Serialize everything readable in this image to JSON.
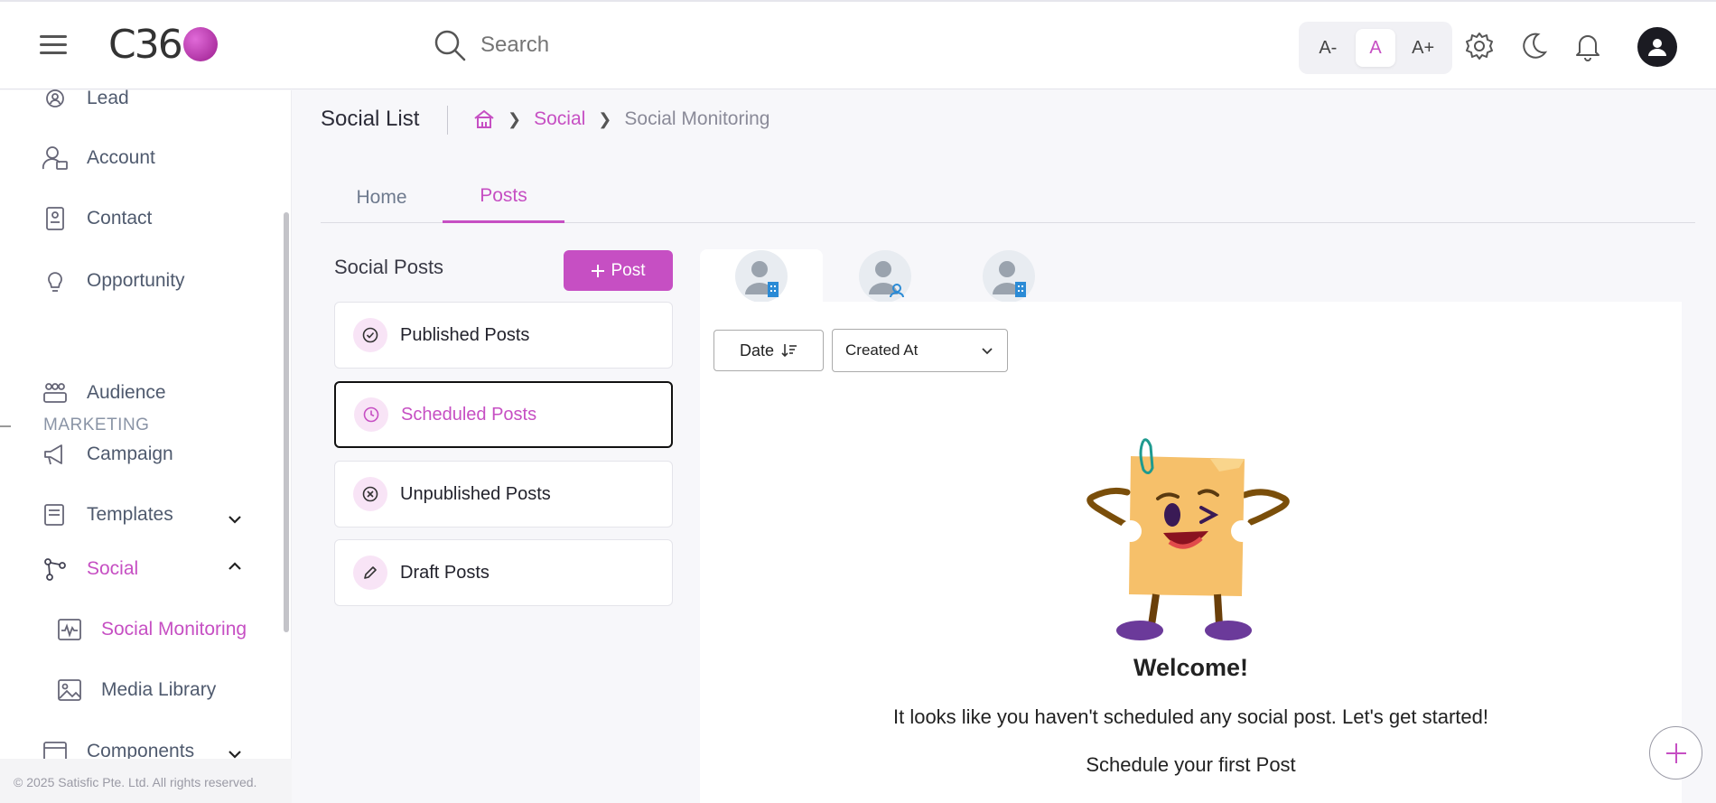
{
  "header": {
    "logo_text": "C36",
    "search_placeholder": "Search",
    "font_sizes": [
      "A-",
      "A",
      "A+"
    ],
    "accent_color": "#c64fc3"
  },
  "sidebar": {
    "items": [
      {
        "label": "Lead",
        "icon": "lead-icon"
      },
      {
        "label": "Account",
        "icon": "account-icon"
      },
      {
        "label": "Contact",
        "icon": "contact-icon"
      },
      {
        "label": "Opportunity",
        "icon": "lightbulb-icon"
      }
    ],
    "section_marketing": "MARKETING",
    "marketing_items": [
      {
        "label": "Audience",
        "icon": "audience-icon"
      },
      {
        "label": "Campaign",
        "icon": "megaphone-icon"
      },
      {
        "label": "Templates",
        "icon": "templates-icon"
      },
      {
        "label": "Social",
        "icon": "share-icon"
      },
      {
        "label": "Social Monitoring",
        "icon": "monitoring-icon"
      },
      {
        "label": "Media Library",
        "icon": "image-icon"
      },
      {
        "label": "Components",
        "icon": "components-icon"
      }
    ],
    "footer": "© 2025 Satisfic Pte. Ltd. All rights reserved."
  },
  "page": {
    "title": "Social List",
    "breadcrumb": {
      "home_icon": "home-icon",
      "section": "Social",
      "current": "Social Monitoring"
    },
    "tabs": [
      "Home",
      "Posts"
    ],
    "active_tab": "Posts"
  },
  "posts": {
    "title": "Social Posts",
    "add_button": "Post",
    "categories": [
      {
        "label": "Published Posts",
        "icon": "check-circle-icon"
      },
      {
        "label": "Scheduled Posts",
        "icon": "clock-icon"
      },
      {
        "label": "Unpublished Posts",
        "icon": "x-circle-icon"
      },
      {
        "label": "Draft Posts",
        "icon": "pencil-icon"
      }
    ],
    "selected": "Scheduled Posts"
  },
  "filters": {
    "sort_label": "Date",
    "sort_field": "Created At"
  },
  "empty_state": {
    "heading": "Welcome!",
    "message": "It looks like you haven't scheduled any social post. Let's get started!",
    "sub": "Schedule your first Post"
  }
}
